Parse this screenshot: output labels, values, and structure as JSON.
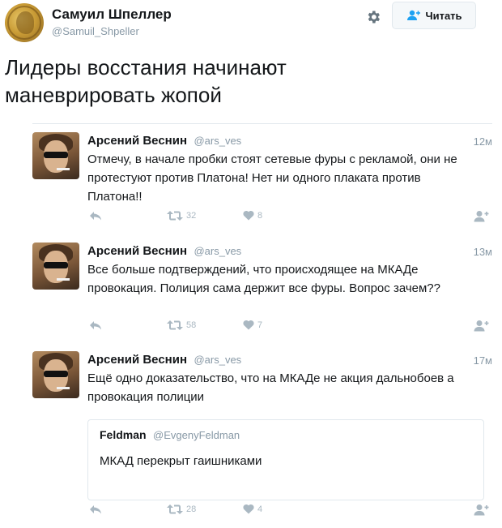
{
  "author": {
    "name": "Самуил Шпеллер",
    "handle": "@Samuil_Shpeller"
  },
  "toolbar": {
    "settings_icon": "gear-icon",
    "follow_label": "Читать",
    "follow_icon": "add-user-icon"
  },
  "tweet": {
    "text": "Лидеры восстания начинают маневрировать жопой"
  },
  "replies": [
    {
      "name": "Арсений Веснин",
      "handle": "@ars_ves",
      "time": "12м",
      "text": "Отмечу, в начале пробки стоят сетевые фуры с рекламой, они не протестуют против Платона! Нет ни одного плаката против Платона!!",
      "retweets": "32",
      "likes": "8"
    },
    {
      "name": "Арсений Веснин",
      "handle": "@ars_ves",
      "time": "13м",
      "text": "Все больше подтверждений, что происходящее на МКАДе провокация. Полиция сама держит все фуры. Вопрос зачем??",
      "retweets": "58",
      "likes": "7"
    },
    {
      "name": "Арсений Веснин",
      "handle": "@ars_ves",
      "time": "17м",
      "text": "Ещё одно доказательство, что на МКАДе не акция дальнобоев а провокация полиции",
      "retweets": "28",
      "likes": "4",
      "quote": {
        "name": "Feldman",
        "handle": "@EvgenyFeldman",
        "text": "МКАД перекрыт гаишниками"
      }
    }
  ],
  "colors": {
    "text": "#14171a",
    "muted": "#8899a6",
    "icon": "#aab8c2",
    "border": "#e1e8ed"
  }
}
